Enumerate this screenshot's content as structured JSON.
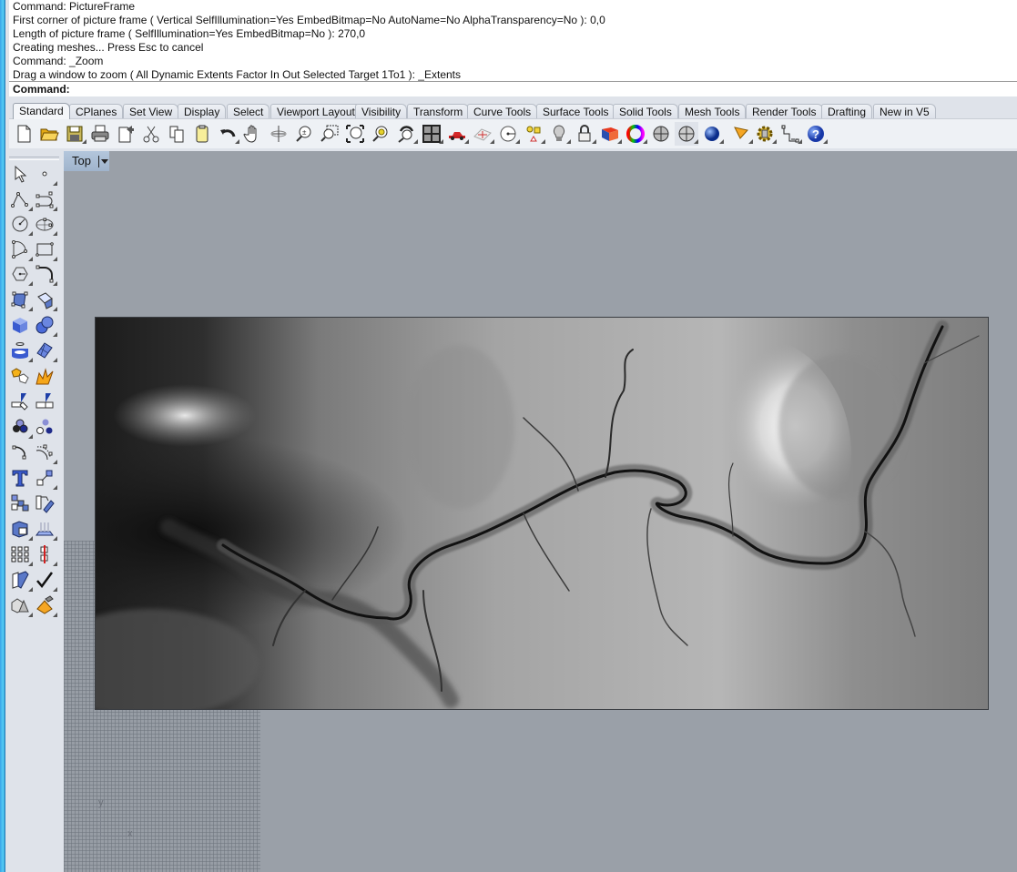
{
  "command_history": [
    "Command: PictureFrame",
    "First corner of picture frame ( Vertical  SelfIllumination=Yes  EmbedBitmap=No  AutoName=No  AlphaTransparency=No ): 0,0",
    "Length of picture frame ( SelfIllumination=Yes  EmbedBitmap=No ): 270,0",
    "Creating meshes... Press Esc to cancel",
    "Command: _Zoom",
    "Drag a window to zoom ( All  Dynamic  Extents  Factor  In  Out  Selected  Target  1To1 ): _Extents"
  ],
  "command_prompt": {
    "label": "Command:",
    "value": ""
  },
  "tabs": [
    {
      "label": "Standard",
      "active": true
    },
    {
      "label": "CPlanes"
    },
    {
      "label": "Set View"
    },
    {
      "label": "Display"
    },
    {
      "label": "Select"
    },
    {
      "label": "Viewport Layout"
    },
    {
      "label": "Visibility"
    },
    {
      "label": "Transform"
    },
    {
      "label": "Curve Tools"
    },
    {
      "label": "Surface Tools"
    },
    {
      "label": "Solid Tools"
    },
    {
      "label": "Mesh Tools"
    },
    {
      "label": "Render Tools"
    },
    {
      "label": "Drafting"
    },
    {
      "label": "New in V5"
    }
  ],
  "toolbar_icons": [
    "new-document-icon",
    "open-folder-icon",
    "save-icon",
    "print-icon",
    "import-export-icon",
    "cut-icon",
    "copy-icon",
    "paste-icon",
    "undo-icon",
    "pan-hand-icon",
    "rotate-view-icon",
    "zoom-dynamic-icon",
    "zoom-window-icon",
    "zoom-extents-icon",
    "zoom-selected-icon",
    "undo-view-icon",
    "four-viewports-icon",
    "car-icon",
    "cplane-icon",
    "distance-icon",
    "select-objects-icon",
    "light-bulb-icon",
    "lock-icon",
    "layer-icon",
    "color-wheel-icon",
    "shaded-sphere-icon",
    "rendered-sphere-icon",
    "blue-sphere-icon",
    "cone-light-icon",
    "options-gear-icon",
    "dimension-icon",
    "help-icon"
  ],
  "left_toolbar_icons": [
    "select-arrow-icon",
    "point-icon",
    "polyline-icon",
    "curve-icon",
    "circle-icon",
    "ellipse-icon",
    "arc-icon",
    "rectangle-icon",
    "polygon-icon",
    "fillet-curve-icon",
    "surface-from-points-icon",
    "extrude-surface-icon",
    "box-icon",
    "sphere-union-icon",
    "cylinder-icon",
    "mesh-surface-icon",
    "join-icon",
    "explode-icon",
    "trim-icon",
    "split-icon",
    "group-icon",
    "ungroup-icon",
    "fillet-icon",
    "offset-curve-icon",
    "text-icon",
    "scale-icon",
    "array-icon",
    "orient-icon",
    "boolean-icon",
    "project-icon",
    "grid-array-icon",
    "mirror-icon",
    "analyze-icon",
    "check-icon",
    "solid-primitives-icon",
    "render-icon"
  ],
  "viewport": {
    "name": "Top",
    "axis_x": "x",
    "axis_y": "y"
  }
}
